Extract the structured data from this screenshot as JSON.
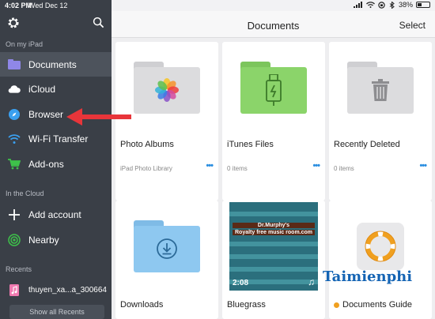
{
  "status": {
    "time": "4:02 PM",
    "date": "Wed Dec 12",
    "battery": "38%",
    "battery_level": 0.38
  },
  "sidebar": {
    "section_on_ipad": "On my iPad",
    "on_ipad_items": [
      {
        "label": "Documents",
        "icon": "folder-icon"
      },
      {
        "label": "iCloud",
        "icon": "cloud-icon"
      },
      {
        "label": "Browser",
        "icon": "compass-icon"
      },
      {
        "label": "Wi-Fi Transfer",
        "icon": "wifi-icon"
      },
      {
        "label": "Add-ons",
        "icon": "cart-icon"
      }
    ],
    "section_cloud": "In the Cloud",
    "cloud_items": [
      {
        "label": "Add account",
        "icon": "plus-icon"
      },
      {
        "label": "Nearby",
        "icon": "nearby-icon"
      }
    ],
    "section_recents": "Recents",
    "recents": [
      {
        "label": "thuyen_xa...a_300664",
        "icon": "music-file-icon"
      }
    ],
    "show_all": "Show all Recents"
  },
  "header": {
    "title": "Documents",
    "select": "Select"
  },
  "cards": [
    {
      "name": "Photo Albums",
      "sub": "iPad Photo Library",
      "more": "•••",
      "icon": "photos-icon",
      "color": "#dcdcde"
    },
    {
      "name": "iTunes Files",
      "sub": "0 items",
      "more": "•••",
      "icon": "usb-icon",
      "color": "#8bd46a"
    },
    {
      "name": "Recently Deleted",
      "sub": "0 items",
      "more": "•••",
      "icon": "trash-icon",
      "color": "#dcdcde"
    },
    {
      "name": "Downloads",
      "icon": "download-icon",
      "color": "#8ec8f0"
    },
    {
      "name": "Bluegrass",
      "icon": "video-thumbnail",
      "video_caption1": "Dr.Murphy's",
      "video_caption2": "Royalty free music room.com",
      "duration": "2:08"
    },
    {
      "name": "Documents Guide",
      "icon": "lifebuoy-icon"
    }
  ],
  "watermark": "Taimienphi",
  "colors": {
    "sidebar": "#3a3f47",
    "accent": "#2a8ee0",
    "arrow": "#e8353a"
  }
}
